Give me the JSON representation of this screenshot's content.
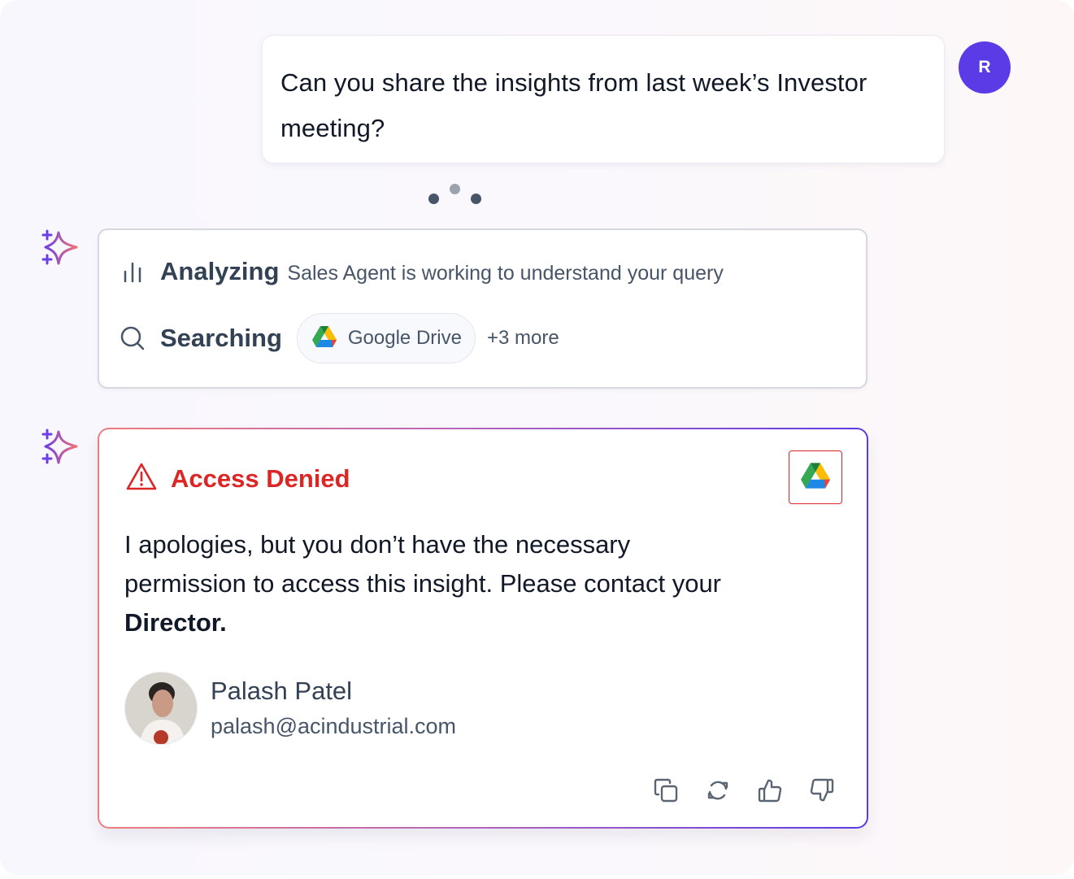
{
  "colors": {
    "accent": "#5b3be6",
    "error": "#dc2626",
    "text_primary": "#111827",
    "text_secondary": "#475569",
    "gradient_start": "#ef7d7d",
    "gradient_end": "#5b3be6"
  },
  "user_message": {
    "text": "Can you share the insights from last week’s Investor meeting?",
    "avatar_initial": "R"
  },
  "typing_indicator": {
    "icon": "typing-dots"
  },
  "status_card": {
    "assistant_icon": "sparkle-icon",
    "analyzing": {
      "icon": "bar-chart-icon",
      "label": "Analyzing",
      "description": "Sales Agent is working to understand your query"
    },
    "searching": {
      "icon": "search-icon",
      "label": "Searching",
      "source_chip": {
        "icon": "google-drive-icon",
        "label": "Google Drive"
      },
      "more_label": "+3 more"
    }
  },
  "denied_card": {
    "assistant_icon": "sparkle-icon",
    "title_icon": "warning-triangle-icon",
    "title": "Access Denied",
    "source_icon": "google-drive-icon",
    "message_prefix": "I apologies, but you don’t have the necessary permission to access this insight. Please contact your ",
    "message_bold": "Director.",
    "contact": {
      "name": "Palash Patel",
      "email": "palash@acindustrial.com"
    },
    "actions": [
      {
        "icon": "copy-icon",
        "label": "Copy"
      },
      {
        "icon": "regenerate-icon",
        "label": "Regenerate"
      },
      {
        "icon": "thumbs-up-icon",
        "label": "Thumbs up"
      },
      {
        "icon": "thumbs-down-icon",
        "label": "Thumbs down"
      }
    ]
  }
}
